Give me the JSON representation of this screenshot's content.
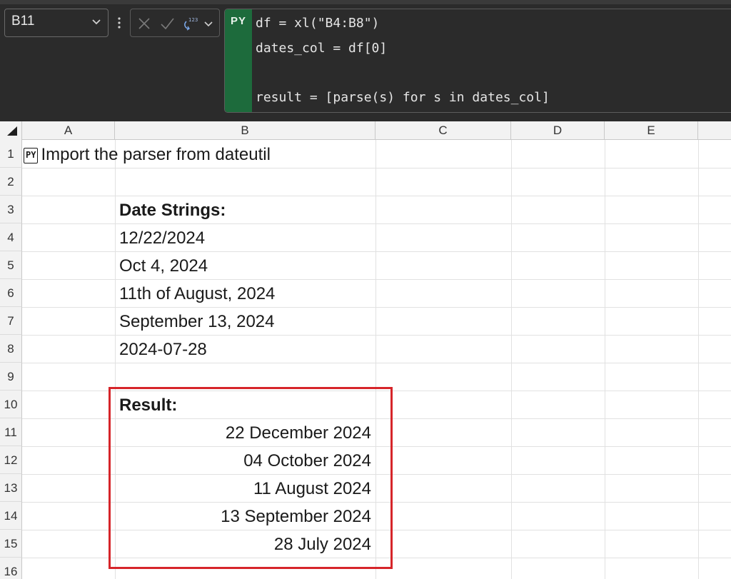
{
  "namebox": {
    "value": "B11"
  },
  "formula": {
    "badge": "PY",
    "lines": [
      "df = xl(\"B4:B8\")",
      "dates_col = df[0]",
      "",
      "result = [parse(s) for s in dates_col]"
    ]
  },
  "grid": {
    "columns": [
      "A",
      "B",
      "C",
      "D",
      "E"
    ],
    "rows": [
      "1",
      "2",
      "3",
      "4",
      "5",
      "6",
      "7",
      "8",
      "9",
      "10",
      "11",
      "12",
      "13",
      "14",
      "15",
      "16"
    ]
  },
  "cells": {
    "a1_tag": "PY",
    "a1_text": "Import the parser from dateutil",
    "b3": "Date Strings:",
    "inputs": [
      "12/22/2024",
      "Oct 4, 2024",
      "11th of August, 2024",
      "September 13, 2024",
      "2024-07-28"
    ],
    "b10": "Result:",
    "results": [
      "22 December 2024",
      "04 October 2024",
      "11 August 2024",
      "13 September 2024",
      "28 July 2024"
    ]
  },
  "colors": {
    "python_green": "#1d6b3c",
    "highlight_red": "#d6252a"
  }
}
